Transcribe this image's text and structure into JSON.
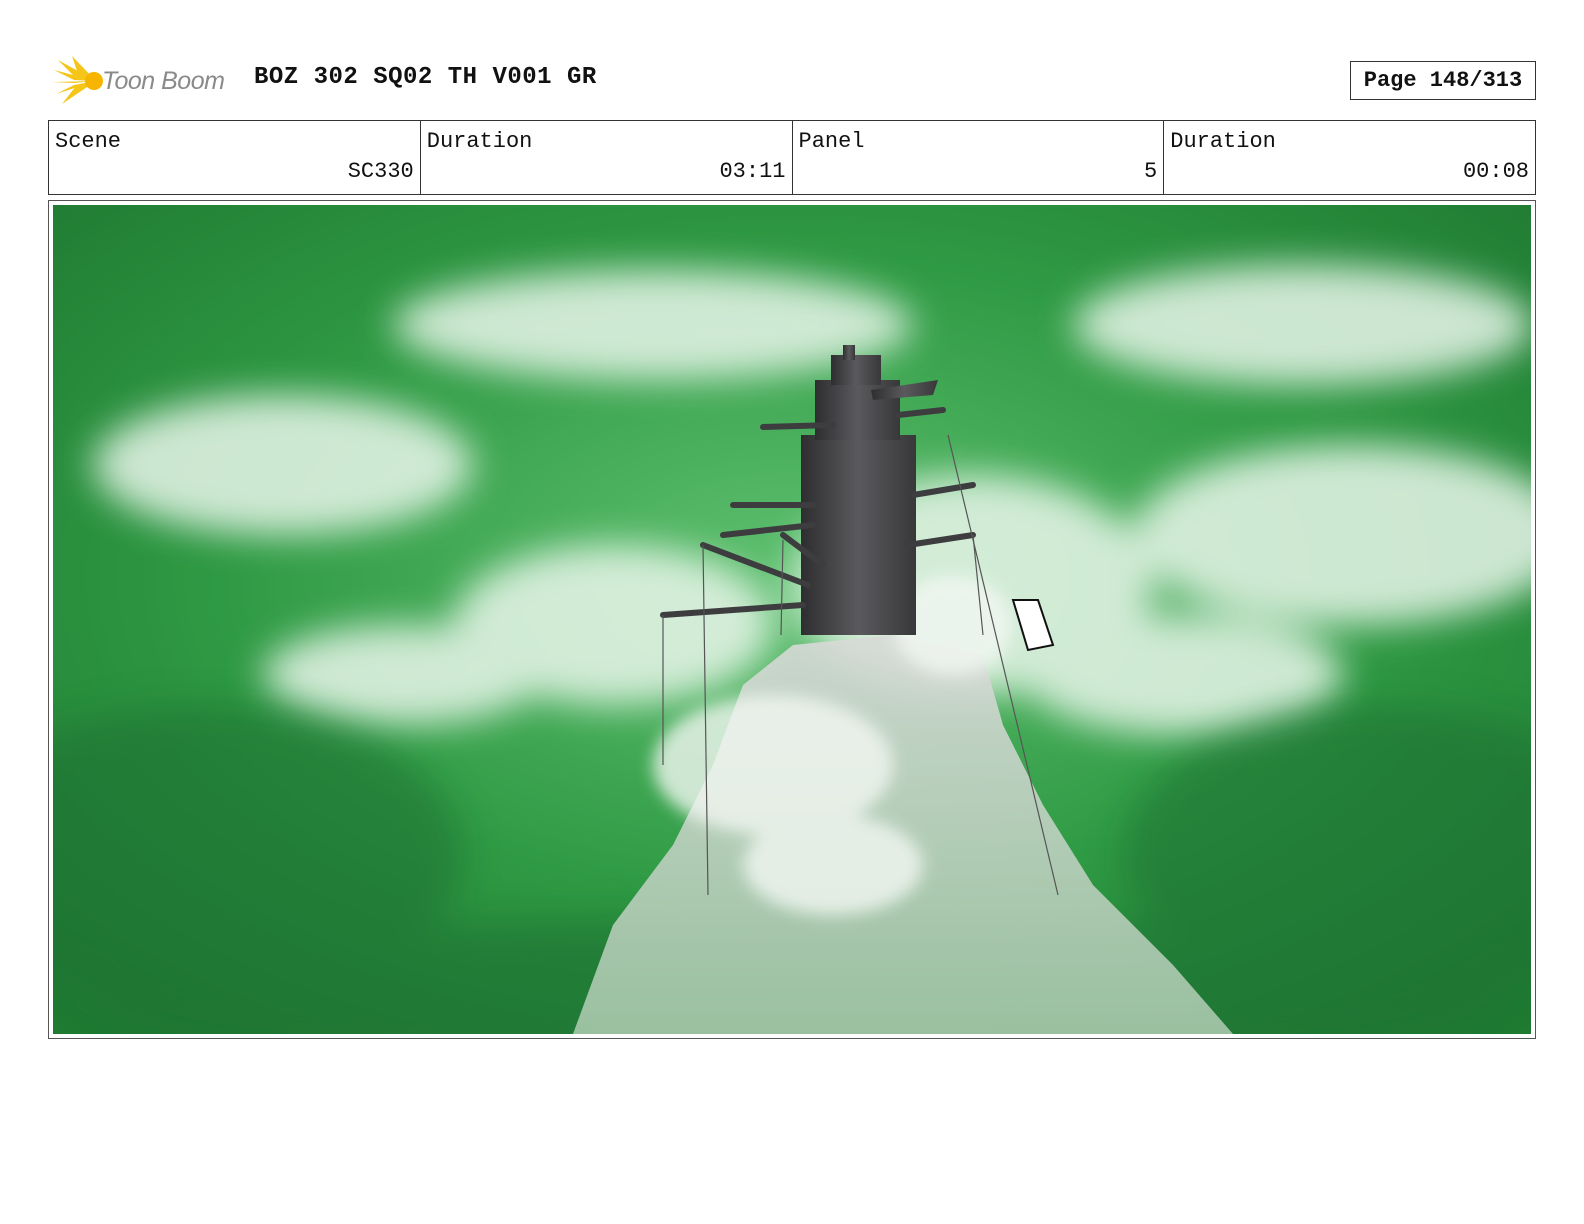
{
  "header": {
    "logo_text": "Toon Boom",
    "logo_icon": "starburst-icon",
    "title": "BOZ 302 SQ02 TH V001 GR",
    "page_label": "Page 148/313"
  },
  "info": [
    {
      "label": "Scene",
      "value": "SC330"
    },
    {
      "label": "Duration",
      "value": "03:11"
    },
    {
      "label": "Panel",
      "value": "5"
    },
    {
      "label": "Duration",
      "value": "00:08"
    }
  ],
  "colors": {
    "sky_green": "#2a8a3c",
    "cloud_white": "#e8f5ea",
    "tower_grey": "#4a4a4c",
    "rock_grey": "#c8cbc8",
    "logo_yellow": "#f5c518"
  }
}
